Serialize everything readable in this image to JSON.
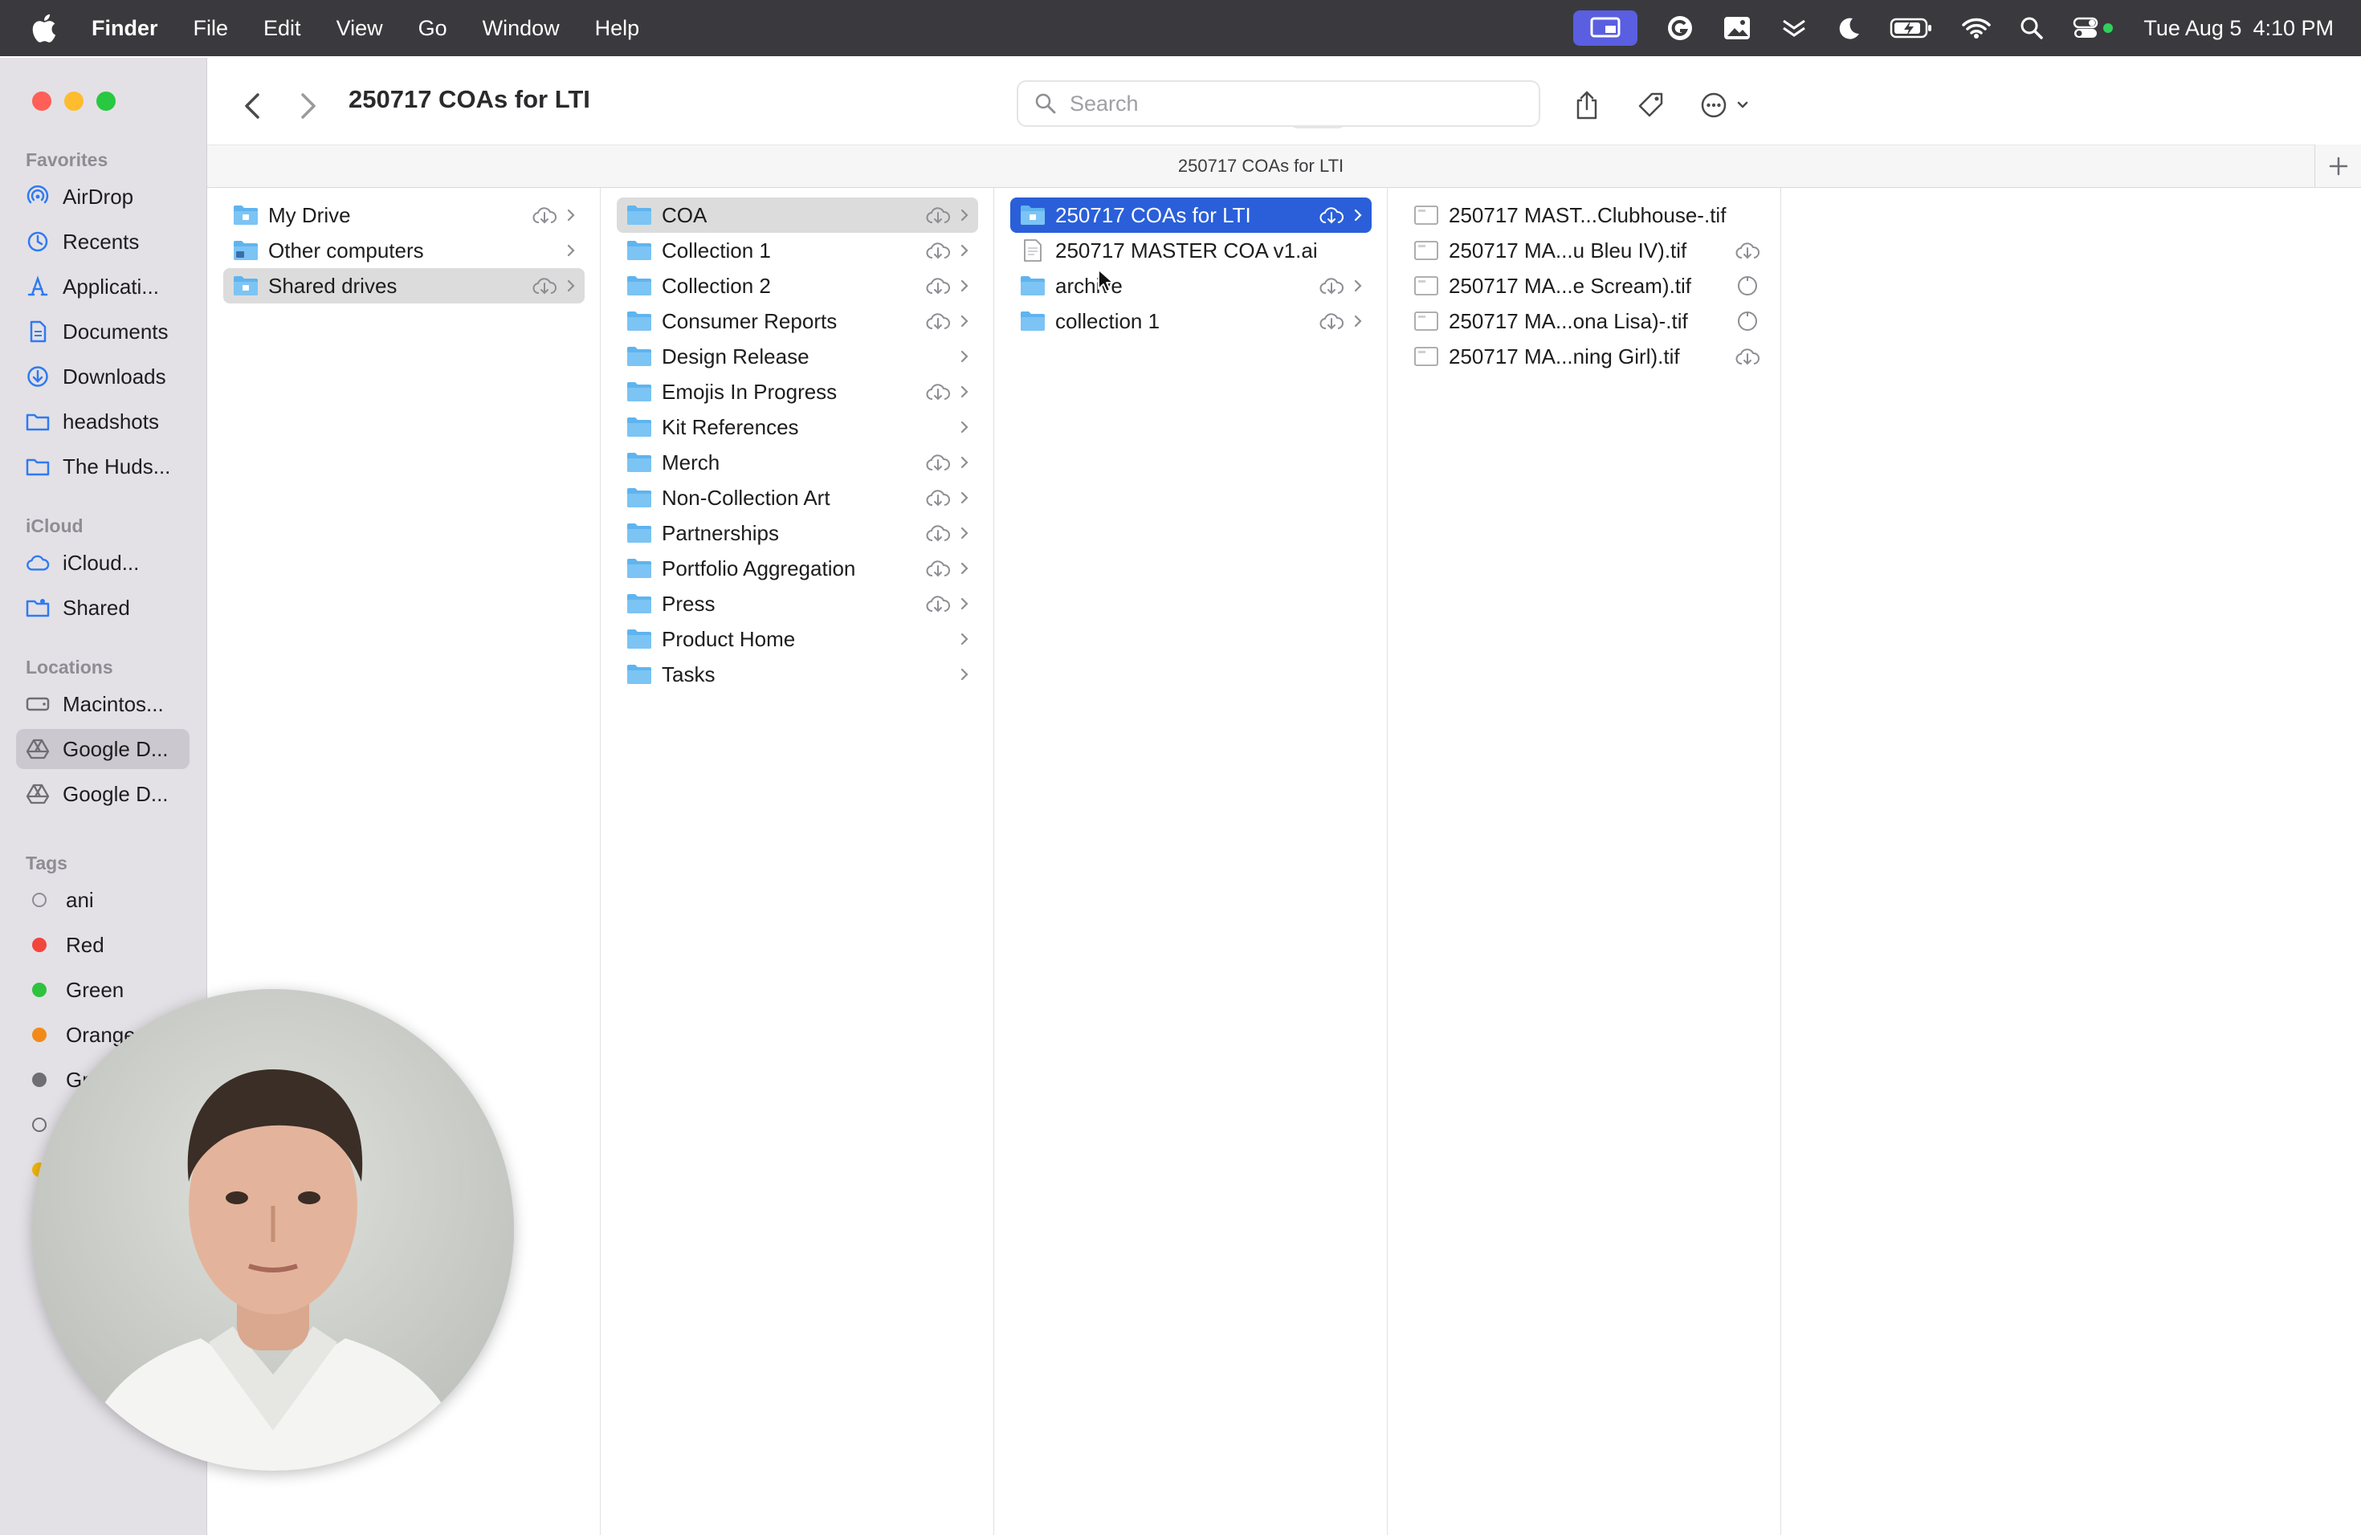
{
  "menubar": {
    "items": [
      {
        "label": "Finder",
        "bold": true
      },
      {
        "label": "File"
      },
      {
        "label": "Edit"
      },
      {
        "label": "View"
      },
      {
        "label": "Go"
      },
      {
        "label": "Window"
      },
      {
        "label": "Help"
      }
    ],
    "status_icons": [
      "screen-share-icon",
      "grammarly-icon",
      "photo-icon",
      "chevrons-down-icon",
      "moon-icon",
      "battery-charging-icon",
      "wifi-icon",
      "spotlight-search-icon",
      "control-center-icon"
    ],
    "clock": {
      "date": "Tue Aug 5",
      "time": "4:10 PM"
    }
  },
  "toolbar": {
    "title": "250717 COAs for LTI",
    "search_placeholder": "Search",
    "view_modes": [
      "icon-view",
      "list-view",
      "column-view",
      "gallery-view"
    ],
    "active_view": "column-view"
  },
  "pathbar": {
    "title": "250717 COAs for LTI"
  },
  "sidebar": {
    "favorites_label": "Favorites",
    "favorites": [
      {
        "label": "AirDrop",
        "icon": "airdrop-icon"
      },
      {
        "label": "Recents",
        "icon": "clock-icon"
      },
      {
        "label": "Applicati...",
        "icon": "applications-icon"
      },
      {
        "label": "Documents",
        "icon": "document-icon"
      },
      {
        "label": "Downloads",
        "icon": "download-icon"
      },
      {
        "label": "headshots",
        "icon": "folder-icon"
      },
      {
        "label": "The Huds...",
        "icon": "folder-icon"
      }
    ],
    "icloud_label": "iCloud",
    "icloud": [
      {
        "label": "iCloud...",
        "icon": "cloud-icon"
      },
      {
        "label": "Shared",
        "icon": "shared-folder-icon"
      }
    ],
    "locations_label": "Locations",
    "locations": [
      {
        "label": "Macintos...",
        "icon": "disk-icon"
      },
      {
        "label": "Google D...",
        "icon": "google-drive-icon",
        "selected": true
      },
      {
        "label": "Google D...",
        "icon": "google-drive-icon"
      }
    ],
    "tags_label": "Tags",
    "tags": [
      {
        "label": "ani",
        "color": "none"
      },
      {
        "label": "Red",
        "color": "#f2453d"
      },
      {
        "label": "Green",
        "color": "#2fc23f"
      },
      {
        "label": "Orange",
        "color": "#f28a1a"
      },
      {
        "label": "Gra",
        "color": "#6e6e73"
      }
    ]
  },
  "columns": {
    "col1": [
      {
        "label": "My Drive",
        "cloud": true,
        "chevron": true
      },
      {
        "label": "Other computers",
        "cloud": false,
        "chevron": true
      },
      {
        "label": "Shared drives",
        "cloud": true,
        "chevron": true,
        "selected": "gray"
      }
    ],
    "col2": [
      {
        "label": "COA",
        "cloud": true,
        "chevron": true,
        "selected": "gray"
      },
      {
        "label": "Collection 1",
        "cloud": true,
        "chevron": true
      },
      {
        "label": "Collection 2",
        "cloud": true,
        "chevron": true
      },
      {
        "label": "Consumer Reports",
        "cloud": true,
        "chevron": true
      },
      {
        "label": "Design Release",
        "cloud": false,
        "chevron": true
      },
      {
        "label": "Emojis In Progress",
        "cloud": true,
        "chevron": true
      },
      {
        "label": "Kit References",
        "cloud": false,
        "chevron": true
      },
      {
        "label": "Merch",
        "cloud": true,
        "chevron": true
      },
      {
        "label": "Non-Collection Art",
        "cloud": true,
        "chevron": true
      },
      {
        "label": "Partnerships",
        "cloud": true,
        "chevron": true
      },
      {
        "label": "Portfolio Aggregation",
        "cloud": true,
        "chevron": true
      },
      {
        "label": "Press",
        "cloud": true,
        "chevron": true
      },
      {
        "label": "Product Home",
        "cloud": false,
        "chevron": true
      },
      {
        "label": "Tasks",
        "cloud": false,
        "chevron": true
      }
    ],
    "col3": [
      {
        "label": "250717 COAs for LTI",
        "kind": "folder",
        "cloud": true,
        "chevron": true,
        "selected": "blue"
      },
      {
        "label": "250717 MASTER COA v1.ai",
        "kind": "file",
        "cloud": false,
        "chevron": false
      },
      {
        "label": "archive",
        "kind": "folder",
        "cloud": true,
        "chevron": true
      },
      {
        "label": "collection 1",
        "kind": "folder",
        "cloud": true,
        "chevron": true
      }
    ],
    "col4": [
      {
        "label": "250717 MAST...Clubhouse-.tif",
        "status": "none"
      },
      {
        "label": "250717 MA...u Bleu IV).tif",
        "status": "cloud"
      },
      {
        "label": "250717 MA...e Scream).tif",
        "status": "progress"
      },
      {
        "label": "250717 MA...ona Lisa)-.tif",
        "status": "progress"
      },
      {
        "label": "250717 MA...ning Girl).tif",
        "status": "cloud"
      }
    ]
  }
}
